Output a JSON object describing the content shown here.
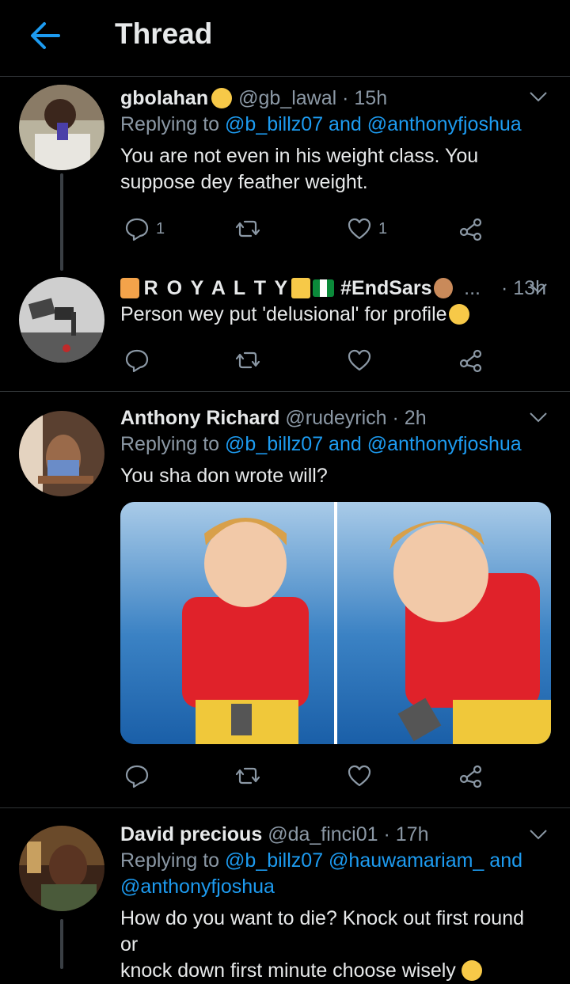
{
  "header": {
    "title": "Thread"
  },
  "tweets": [
    {
      "name": "gbolahan",
      "handle": "@gb_lawal",
      "time": "· 15h",
      "replying_prefix": "Replying to ",
      "replying_to_1": "@b_billz07",
      "replying_sep": " and ",
      "replying_to_2": "@anthonyfjoshua",
      "text_line1": "You are not even in his weight class. You",
      "text_line2": "suppose dey feather weight.",
      "replies": "1",
      "likes": "1"
    },
    {
      "name": "R O Y A L T Y",
      "hashtag": "#EndSars",
      "more": "...",
      "time": "· 13h",
      "text": "Person wey put 'delusional' for profile"
    },
    {
      "name": "Anthony Richard",
      "handle": "@rudeyrich",
      "time": "· 2h",
      "replying_prefix": "Replying to ",
      "replying_to_1": "@b_billz07",
      "replying_sep": " and ",
      "replying_to_2": "@anthonyfjoshua",
      "text": "You sha don wrote will?"
    },
    {
      "name": "David precious",
      "handle": "@da_finci01",
      "time": "· 17h",
      "replying_prefix": "Replying to ",
      "replying_to_1": "@b_billz07",
      "replying_to_2": "@hauwamariam_",
      "replying_sep": " and",
      "replying_to_3": "@anthonyfjoshua",
      "text_line1": "How do you want to die? Knock out first round or",
      "text_line2": "knock down first minute choose wisely"
    }
  ],
  "colors": {
    "accent": "#1d9bf0",
    "secondary": "#8b98a5",
    "background": "#000000"
  },
  "icons": [
    "back-arrow-icon",
    "reply-icon",
    "retweet-icon",
    "like-icon",
    "share-icon",
    "chevron-down-icon"
  ]
}
